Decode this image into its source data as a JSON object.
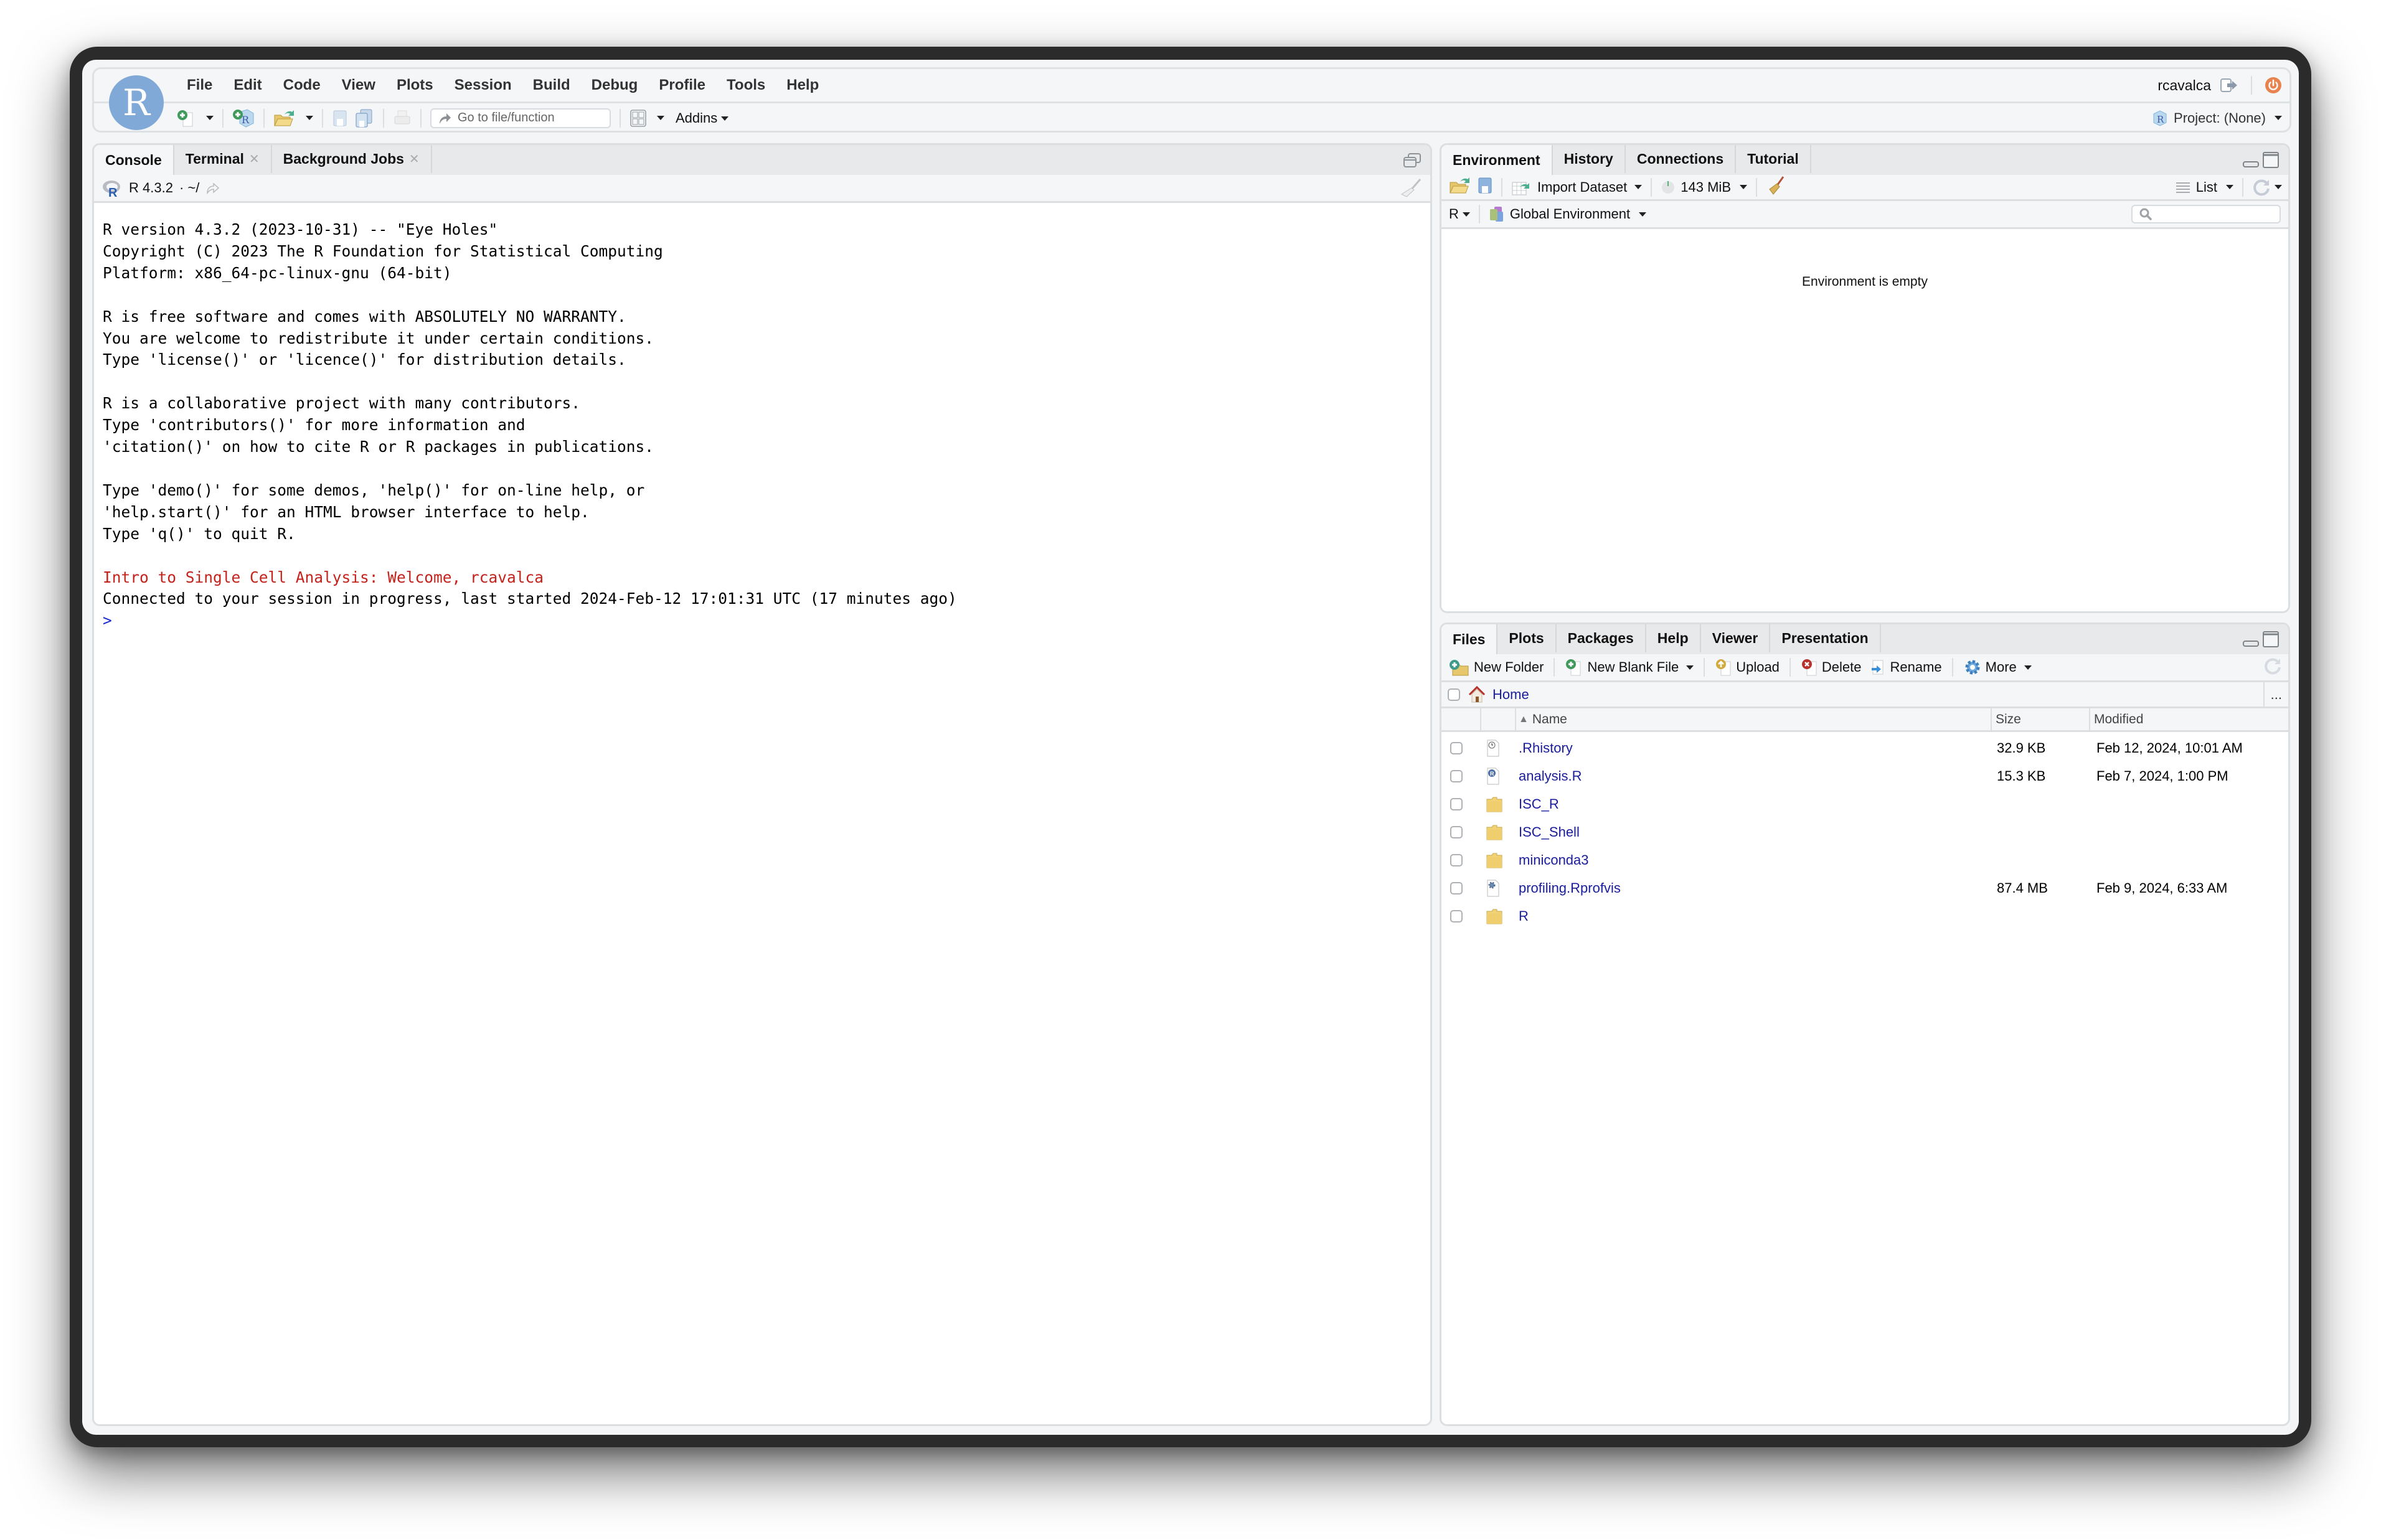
{
  "app": {
    "logo_letter": "R",
    "menu": [
      "File",
      "Edit",
      "Code",
      "View",
      "Plots",
      "Session",
      "Build",
      "Debug",
      "Profile",
      "Tools",
      "Help"
    ],
    "username": "rcavalca",
    "toolbar": {
      "goto_placeholder": "Go to file/function",
      "addins_label": "Addins"
    },
    "project_label": "Project: (None)",
    "colors": {
      "accent": "#80a9d8",
      "power": "#e8834f",
      "link": "#1a1d9c",
      "console_red": "#c4221b",
      "prompt": "#1a2ad1"
    }
  },
  "console": {
    "tabs": [
      {
        "label": "Console",
        "closable": false,
        "active": true
      },
      {
        "label": "Terminal",
        "closable": true,
        "active": false
      },
      {
        "label": "Background Jobs",
        "closable": true,
        "active": false
      }
    ],
    "r_version": "R 4.3.2",
    "working_dir": "· ~/",
    "lines": [
      {
        "text": "R version 4.3.2 (2023-10-31) -- \"Eye Holes\"",
        "style": "normal"
      },
      {
        "text": "Copyright (C) 2023 The R Foundation for Statistical Computing",
        "style": "normal"
      },
      {
        "text": "Platform: x86_64-pc-linux-gnu (64-bit)",
        "style": "normal"
      },
      {
        "text": "",
        "style": "normal"
      },
      {
        "text": "R is free software and comes with ABSOLUTELY NO WARRANTY.",
        "style": "normal"
      },
      {
        "text": "You are welcome to redistribute it under certain conditions.",
        "style": "normal"
      },
      {
        "text": "Type 'license()' or 'licence()' for distribution details.",
        "style": "normal"
      },
      {
        "text": "",
        "style": "normal"
      },
      {
        "text": "R is a collaborative project with many contributors.",
        "style": "normal"
      },
      {
        "text": "Type 'contributors()' for more information and",
        "style": "normal"
      },
      {
        "text": "'citation()' on how to cite R or R packages in publications.",
        "style": "normal"
      },
      {
        "text": "",
        "style": "normal"
      },
      {
        "text": "Type 'demo()' for some demos, 'help()' for on-line help, or",
        "style": "normal"
      },
      {
        "text": "'help.start()' for an HTML browser interface to help.",
        "style": "normal"
      },
      {
        "text": "Type 'q()' to quit R.",
        "style": "normal"
      },
      {
        "text": "",
        "style": "normal"
      },
      {
        "text": "Intro to Single Cell Analysis: Welcome, rcavalca",
        "style": "red"
      },
      {
        "text": "Connected to your session in progress, last started 2024-Feb-12 17:01:31 UTC (17 minutes ago)",
        "style": "normal"
      },
      {
        "text": ">",
        "style": "prompt"
      }
    ]
  },
  "environment": {
    "tabs": [
      {
        "label": "Environment",
        "active": true
      },
      {
        "label": "History",
        "active": false
      },
      {
        "label": "Connections",
        "active": false
      },
      {
        "label": "Tutorial",
        "active": false
      }
    ],
    "import_label": "Import Dataset",
    "memory_label": "143 MiB",
    "view_mode": "List",
    "language": "R",
    "scope": "Global Environment",
    "search_placeholder": "",
    "empty_message": "Environment is empty"
  },
  "files": {
    "tabs": [
      {
        "label": "Files",
        "active": true
      },
      {
        "label": "Plots",
        "active": false
      },
      {
        "label": "Packages",
        "active": false
      },
      {
        "label": "Help",
        "active": false
      },
      {
        "label": "Viewer",
        "active": false
      },
      {
        "label": "Presentation",
        "active": false
      }
    ],
    "toolbar": {
      "new_folder": "New Folder",
      "new_blank_file": "New Blank File",
      "upload": "Upload",
      "delete": "Delete",
      "rename": "Rename",
      "more": "More"
    },
    "path": "Home",
    "more_path": "...",
    "columns": {
      "name": "Name",
      "size": "Size",
      "modified": "Modified"
    },
    "sort": {
      "column": "name",
      "direction": "ascending"
    },
    "rows": [
      {
        "name": ".Rhistory",
        "icon": "history-file-icon",
        "size": "32.9 KB",
        "modified": "Feb 12, 2024, 10:01 AM"
      },
      {
        "name": "analysis.R",
        "icon": "r-script-icon",
        "size": "15.3 KB",
        "modified": "Feb 7, 2024, 1:00 PM"
      },
      {
        "name": "ISC_R",
        "icon": "folder-icon",
        "size": "",
        "modified": ""
      },
      {
        "name": "ISC_Shell",
        "icon": "folder-icon",
        "size": "",
        "modified": ""
      },
      {
        "name": "miniconda3",
        "icon": "folder-icon",
        "size": "",
        "modified": ""
      },
      {
        "name": "profiling.Rprofvis",
        "icon": "profvis-file-icon",
        "size": "87.4 MB",
        "modified": "Feb 9, 2024, 6:33 AM"
      },
      {
        "name": "R",
        "icon": "folder-icon",
        "size": "",
        "modified": ""
      }
    ]
  }
}
